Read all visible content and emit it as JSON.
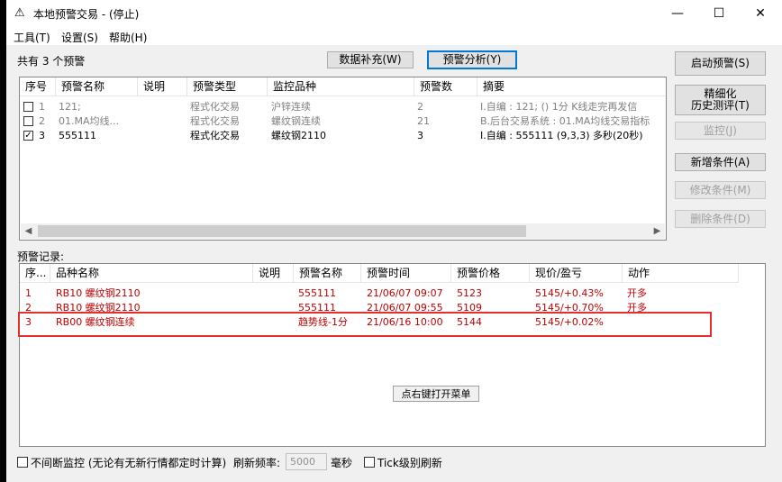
{
  "window": {
    "title": "本地预警交易 - (停止)",
    "icon": "⚠",
    "minimize": "—",
    "maximize": "☐",
    "close": "✕"
  },
  "menu": [
    "工具(T)",
    "设置(S)",
    "帮助(H)"
  ],
  "count_label": "共有 3 个预警",
  "toolbar": {
    "supplement": "数据补充(W)",
    "analysis": "预警分析(Y)"
  },
  "side_buttons": {
    "start": "启动预警(S)",
    "refine_line1": "精细化",
    "refine_line2": "历史测评(T)",
    "monitor": "监控(J)",
    "add": "新增条件(A)",
    "modify": "修改条件(M)",
    "delete": "删除条件(D)"
  },
  "alerts_table": {
    "headers": [
      "序号",
      "预警名称",
      "说明",
      "预警类型",
      "监控品种",
      "预警数",
      "摘要"
    ],
    "rows": [
      {
        "checked": false,
        "no": "1",
        "name": "121;",
        "desc": "",
        "type": "程式化交易",
        "symbol": "沪锌连续",
        "count": "2",
        "summary": "I.自编 : 121; () 1分 K线走完再发信",
        "dim": true
      },
      {
        "checked": false,
        "no": "2",
        "name": "01.MA均线...",
        "desc": "",
        "type": "程式化交易",
        "symbol": "螺纹钢连续",
        "count": "21",
        "summary": "B.后台交易系统 : 01.MA均线交易指标",
        "dim": true
      },
      {
        "checked": true,
        "no": "3",
        "name": "555111",
        "desc": "",
        "type": "程式化交易",
        "symbol": "螺纹钢2110",
        "count": "3",
        "summary": "I.自编 : 555111 (9,3,3) 多秒(20秒)",
        "dim": false
      }
    ]
  },
  "records_label": "预警记录:",
  "records_table": {
    "headers": [
      "序...",
      "品种名称",
      "说明",
      "预警名称",
      "预警时间",
      "预警价格",
      "现价/盈亏",
      "动作"
    ],
    "rows": [
      {
        "no": "1",
        "symbol": "RB10 螺纹钢2110",
        "desc": "",
        "alert": "555111",
        "time": "21/06/07 09:07",
        "price": "5123",
        "current": "5145/+0.43%",
        "action": "开多"
      },
      {
        "no": "2",
        "symbol": "RB10 螺纹钢2110",
        "desc": "",
        "alert": "555111",
        "time": "21/06/07 09:55",
        "price": "5109",
        "current": "5145/+0.70%",
        "action": "开多"
      },
      {
        "no": "3",
        "symbol": "RB00 螺纹钢连续",
        "desc": "",
        "alert": "趋势线-1分",
        "time": "21/06/16 10:00",
        "price": "5144",
        "current": "5145/+0.02%",
        "action": ""
      }
    ]
  },
  "context_hint": "点右键打开菜单",
  "bottom": {
    "continuous_label": "不间断监控 (无论有无新行情都定时计算)",
    "refresh_label": "刷新频率:",
    "refresh_value": "5000",
    "unit": "毫秒",
    "tick_label": "Tick级别刷新"
  }
}
